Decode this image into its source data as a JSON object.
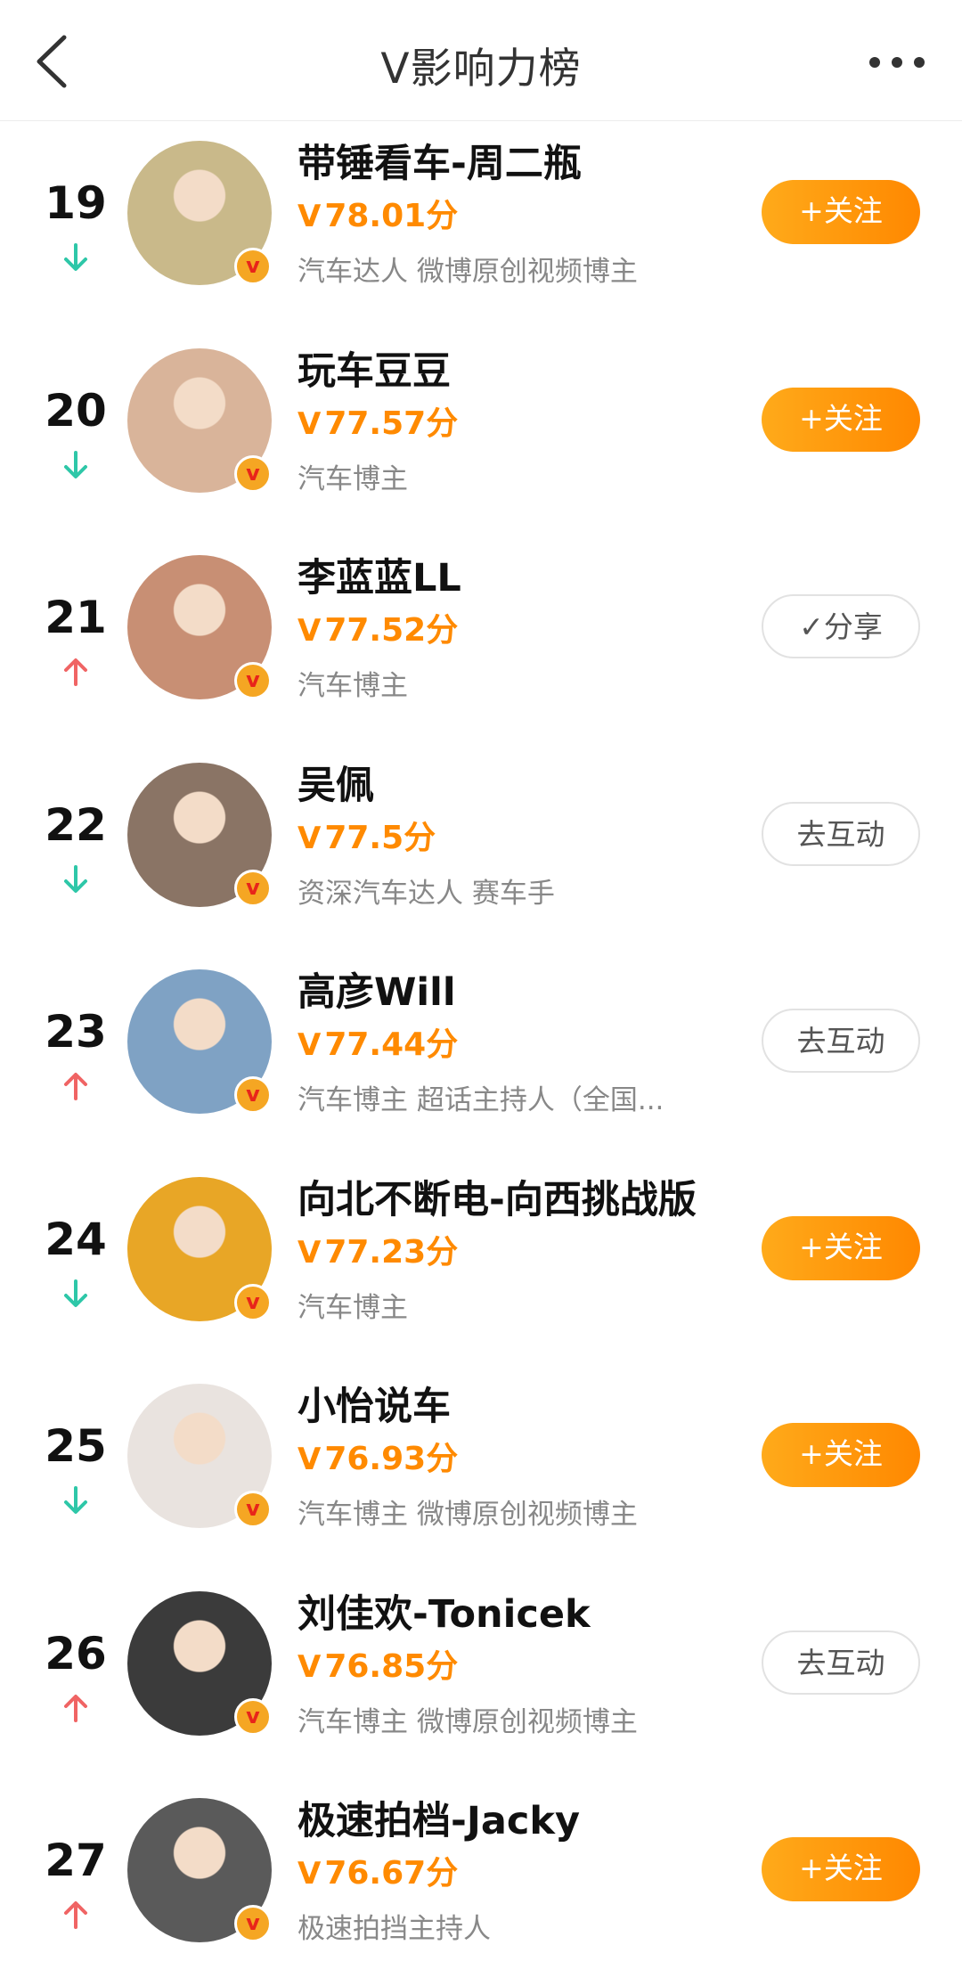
{
  "header": {
    "title": "V影响力榜",
    "back_icon": "chevron-left-icon",
    "more_icon": "more-dots-icon"
  },
  "colors": {
    "accent": "#ff8a00",
    "up": "#f06464",
    "down": "#2ec7a8"
  },
  "rows": [
    {
      "rank": "19",
      "trend": "down",
      "name": "带锤看车-周二瓶",
      "score_prefix": "V",
      "score": "78.01分",
      "desc": "汽车达人 微博原创视频博主",
      "button": "+关注",
      "button_type": "follow",
      "avatar_color": "#c9b98a"
    },
    {
      "rank": "20",
      "trend": "down",
      "name": "玩车豆豆",
      "score_prefix": "V",
      "score": "77.57分",
      "desc": "汽车博主",
      "button": "+关注",
      "button_type": "follow",
      "avatar_color": "#d9b49a"
    },
    {
      "rank": "21",
      "trend": "up",
      "name": "李蓝蓝LL",
      "score_prefix": "V",
      "score": "77.52分",
      "desc": "汽车博主",
      "button": "✓分享",
      "button_type": "outline",
      "avatar_color": "#c88f74"
    },
    {
      "rank": "22",
      "trend": "down",
      "name": "吴佩",
      "score_prefix": "V",
      "score": "77.5分",
      "desc": "资深汽车达人 赛车手",
      "button": "去互动",
      "button_type": "outline",
      "avatar_color": "#8a7465"
    },
    {
      "rank": "23",
      "trend": "up",
      "name": "高彦Will",
      "score_prefix": "V",
      "score": "77.44分",
      "desc": "汽车博主 超话主持人（全国...",
      "button": "去互动",
      "button_type": "outline",
      "avatar_color": "#7fa2c4"
    },
    {
      "rank": "24",
      "trend": "down",
      "name": "向北不断电-向西挑战版",
      "score_prefix": "V",
      "score": "77.23分",
      "desc": "汽车博主",
      "button": "+关注",
      "button_type": "follow",
      "avatar_color": "#e8a626"
    },
    {
      "rank": "25",
      "trend": "down",
      "name": "小怡说车",
      "score_prefix": "V",
      "score": "76.93分",
      "desc": "汽车博主 微博原创视频博主",
      "button": "+关注",
      "button_type": "follow",
      "avatar_color": "#e9e3df"
    },
    {
      "rank": "26",
      "trend": "up",
      "name": "刘佳欢-Tonicek",
      "score_prefix": "V",
      "score": "76.85分",
      "desc": "汽车博主 微博原创视频博主",
      "button": "去互动",
      "button_type": "outline",
      "avatar_color": "#3b3b3b"
    },
    {
      "rank": "27",
      "trend": "up",
      "name": "极速拍档-Jacky",
      "score_prefix": "V",
      "score": "76.67分",
      "desc": "极速拍挡主持人",
      "button": "+关注",
      "button_type": "follow",
      "avatar_color": "#5a5a5a"
    }
  ]
}
